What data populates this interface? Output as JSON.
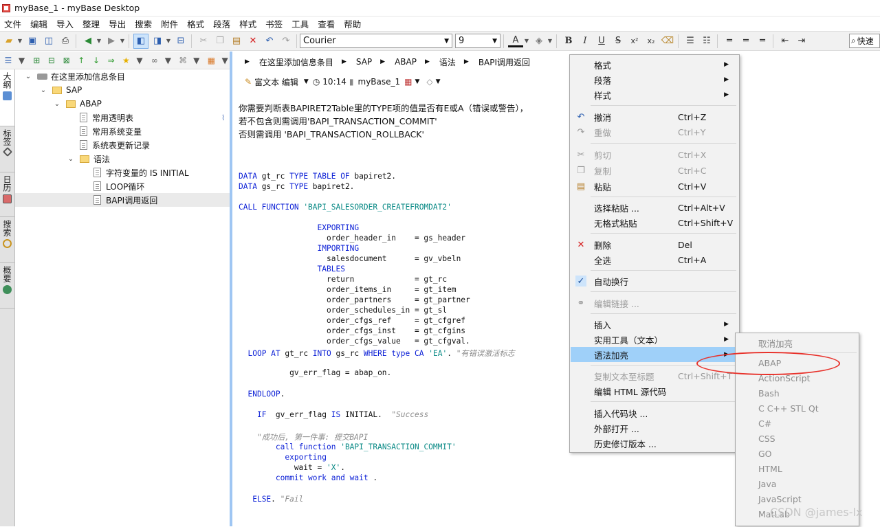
{
  "window": {
    "title": "myBase_1 - myBase Desktop"
  },
  "menu": [
    "文件",
    "编辑",
    "导入",
    "整理",
    "导出",
    "搜索",
    "附件",
    "格式",
    "段落",
    "样式",
    "书签",
    "工具",
    "查看",
    "帮助"
  ],
  "toolbar": {
    "font": "Courier",
    "size": "9",
    "search_placeholder": "快速"
  },
  "vtabs": [
    "大纲",
    "标签",
    "日历",
    "搜索",
    "概要"
  ],
  "tree": {
    "root": "在这里添加信息条目",
    "sap": "SAP",
    "abap": "ABAP",
    "item1": "常用透明表",
    "item2": "常用系统变量",
    "item3": "系统表更新记录",
    "grammar": "语法",
    "g1": "字符变量的 IS INITIAL",
    "g2": "LOOP循环",
    "g3": "BAPI调用返回"
  },
  "breadcrumb": [
    "在这里添加信息条目",
    "SAP",
    "ABAP",
    "语法",
    "BAPI调用返回"
  ],
  "editor_toolbar": {
    "mode": "富文本 编辑",
    "time": "10:14",
    "db": "myBase_1"
  },
  "content": {
    "p1": "你需要判断表BAPIRET2Table里的TYPE项的值是否有E或A（错误或警告），",
    "p2": "若不包含则需调用'BAPI_TRANSACTION_COMMIT'",
    "p3": "否则需调用 'BAPI_TRANSACTION_ROLLBACK'"
  },
  "context_menu": {
    "format": "格式",
    "paragraph": "段落",
    "style": "样式",
    "undo": "撤消",
    "undo_sc": "Ctrl+Z",
    "redo": "重做",
    "redo_sc": "Ctrl+Y",
    "cut": "剪切",
    "cut_sc": "Ctrl+X",
    "copy": "复制",
    "copy_sc": "Ctrl+C",
    "paste": "粘贴",
    "paste_sc": "Ctrl+V",
    "paste_special": "选择粘贴 ...",
    "paste_special_sc": "Ctrl+Alt+V",
    "paste_plain": "无格式粘贴",
    "paste_plain_sc": "Ctrl+Shift+V",
    "delete": "删除",
    "delete_sc": "Del",
    "select_all": "全选",
    "select_all_sc": "Ctrl+A",
    "word_wrap": "自动换行",
    "edit_link": "编辑链接 ...",
    "insert": "插入",
    "tools": "实用工具（文本）",
    "syntax": "语法加亮",
    "copy_to_title": "复制文本至标题",
    "copy_to_title_sc": "Ctrl+Shift+T",
    "edit_html": "编辑 HTML 源代码",
    "insert_code": "插入代码块 ...",
    "open_external": "外部打开 ...",
    "history": "历史修订版本 ..."
  },
  "syntax_menu": [
    "取消加亮",
    "ABAP",
    "ActionScript",
    "Bash",
    "C C++ STL Qt",
    "C#",
    "CSS",
    "GO",
    "HTML",
    "Java",
    "JavaScript",
    "MatLab"
  ],
  "watermark": "CSDN @james-lx"
}
